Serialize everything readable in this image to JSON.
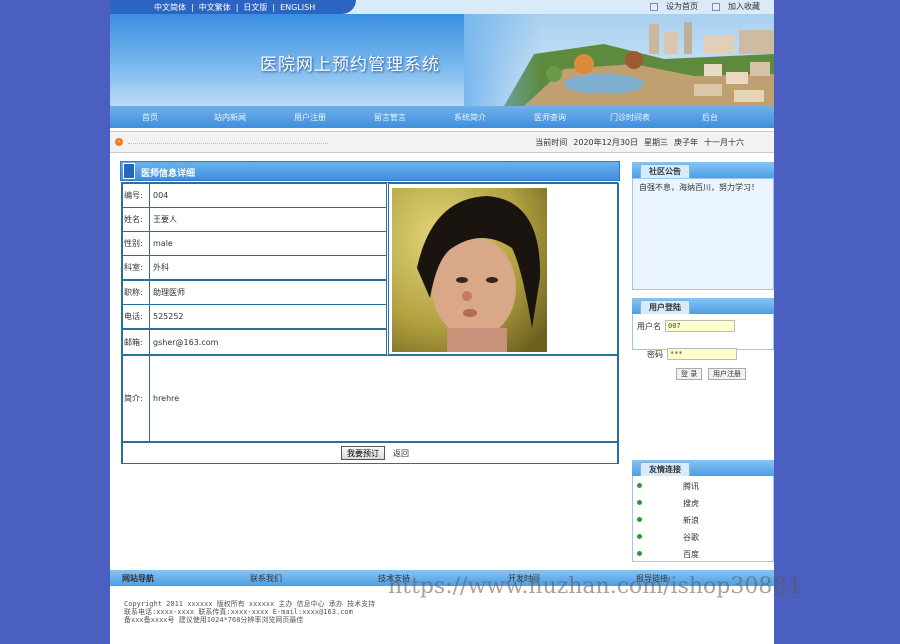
{
  "language_links": [
    "中文简体",
    "中文繁体",
    "日文版",
    "ENGLISH"
  ],
  "top_links": {
    "homepage": "设为首页",
    "favorite": "加入收藏"
  },
  "site_title": "医院网上预约管理系统",
  "nav": [
    "首页",
    "站内新闻",
    "用户注册",
    "留言管言",
    "系统简介",
    "医师查询",
    "门诊时间表",
    "后台"
  ],
  "date_bar": {
    "label": "当前时间",
    "date": "2020年12月30日",
    "weekday": "星期三",
    "ganzhi": "庚子年",
    "lunar": "十一月十六"
  },
  "panel_title": "医师信息详细",
  "doctor": {
    "fields": [
      {
        "label": "编号:",
        "value": "004"
      },
      {
        "label": "姓名:",
        "value": "王要人"
      },
      {
        "label": "性别:",
        "value": "male"
      },
      {
        "label": "科室:",
        "value": "外科"
      },
      {
        "label": "职称:",
        "value": "助理医师"
      },
      {
        "label": "电话:",
        "value": "525252"
      },
      {
        "label": "邮箱:",
        "value": "gsher@163.com"
      }
    ],
    "intro_label": "简介:",
    "intro": "hrehre"
  },
  "buttons": {
    "book": "我要预订",
    "back": "返回"
  },
  "notice": {
    "title": "社区公告",
    "text": "自强不息，海纳百川，努力学习！"
  },
  "login": {
    "title": "用户登陆",
    "username_label": "用户名",
    "username_value": "007",
    "password_label": "密码",
    "password_value": "***",
    "login_button": "登 录",
    "register_button": "用户注册"
  },
  "friend_links": {
    "title": "友情连接",
    "items": [
      "腾讯",
      "搜虎",
      "新浪",
      "谷歌",
      "百度"
    ]
  },
  "footer": {
    "nav_title": "网站导航",
    "links": [
      "联系我们",
      "技术支持",
      "开发时间",
      "报导链接"
    ],
    "copyright_lines": [
      "Copyright 2011 xxxxxx 版权所有 xxxxxx 主办 信息中心 承办 技术支持",
      "联系电话:xxxx-xxxx 联系传真:xxxx-xxxx E-mail:xxxx@163.com",
      "备xxx备xxxx号  建议使用1024*768分辨率浏览网页最佳"
    ]
  },
  "watermark": "https://www.huzhan.com/ishop30884",
  "colors": {
    "page_bg": "#4a5fbf",
    "nav_blue": "#3f8fde",
    "lang_tab": "#2c64c4",
    "table_border": "#2a6f9e",
    "input_bg": "#ffffcc"
  }
}
